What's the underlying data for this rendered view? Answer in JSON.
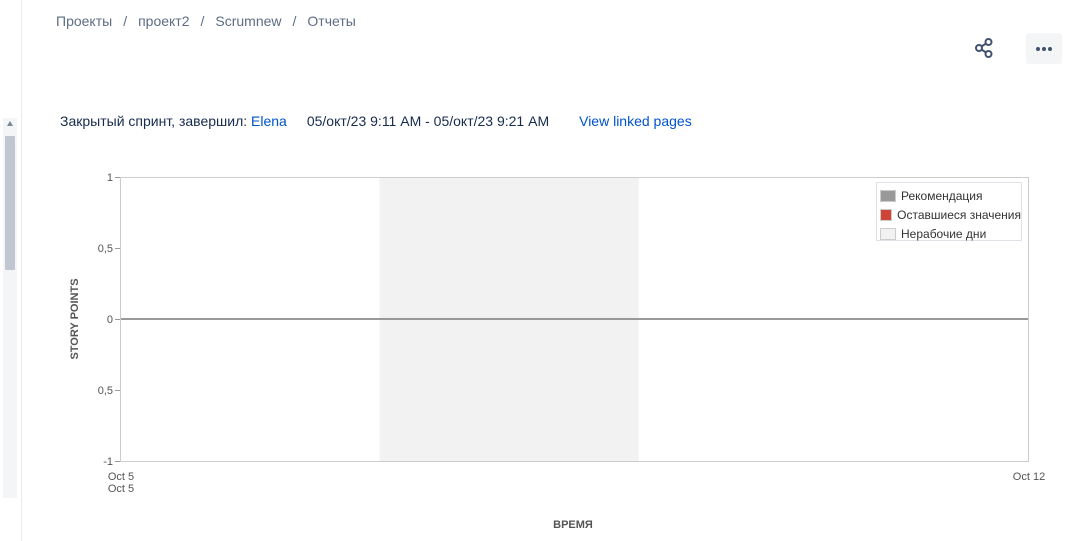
{
  "breadcrumbs": [
    "Проекты",
    "проект2",
    "Scrumnew",
    "Отчеты"
  ],
  "breadcrumb_separator": "/",
  "sprint": {
    "label": "Закрытый спринт, завершил:",
    "user": "Elena",
    "dates": "05/окт/23 9:11 AM - 05/окт/23 9:21 AM",
    "view_linked": "View linked pages"
  },
  "icons": {
    "share": "share-icon",
    "more": "more-horizontal-icon"
  },
  "colors": {
    "link": "#0052cc",
    "guideline": "#999999",
    "remaining": "#d04437",
    "non_working": "#f2f2f2"
  },
  "chart_data": {
    "type": "line",
    "xlabel": "ВРЕМЯ",
    "ylabel": "STORY POINTS",
    "ylim": [
      -1,
      1
    ],
    "y_ticks": [
      {
        "value": 1,
        "label": "1"
      },
      {
        "value": 0.5,
        "label": "0,5"
      },
      {
        "value": 0,
        "label": "0"
      },
      {
        "value": -0.5,
        "label": "0,5"
      },
      {
        "value": -1,
        "label": "-1"
      }
    ],
    "x_range": [
      "2023-10-05",
      "2023-10-12"
    ],
    "x_ticks": [
      {
        "value": "2023-10-05",
        "label": "Oct 5",
        "sublabel": "Oct 5"
      },
      {
        "value": "2023-10-12",
        "label": "Oct 12",
        "sublabel": ""
      }
    ],
    "non_working_days": [
      [
        "2023-10-07",
        "2023-10-09"
      ]
    ],
    "series": [
      {
        "name": "Рекомендация",
        "color": "#999999",
        "points": [
          [
            "2023-10-05",
            0
          ],
          [
            "2023-10-12",
            0
          ]
        ]
      },
      {
        "name": "Оставшиеся значения",
        "color": "#d04437",
        "points": []
      }
    ],
    "legend": [
      {
        "name": "Рекомендация",
        "color": "#999999"
      },
      {
        "name": "Оставшиеся значения",
        "color": "#d04437"
      },
      {
        "name": "Нерабочие дни",
        "color": "#f2f2f2"
      }
    ],
    "legend_position": "top-right",
    "grid": false
  }
}
